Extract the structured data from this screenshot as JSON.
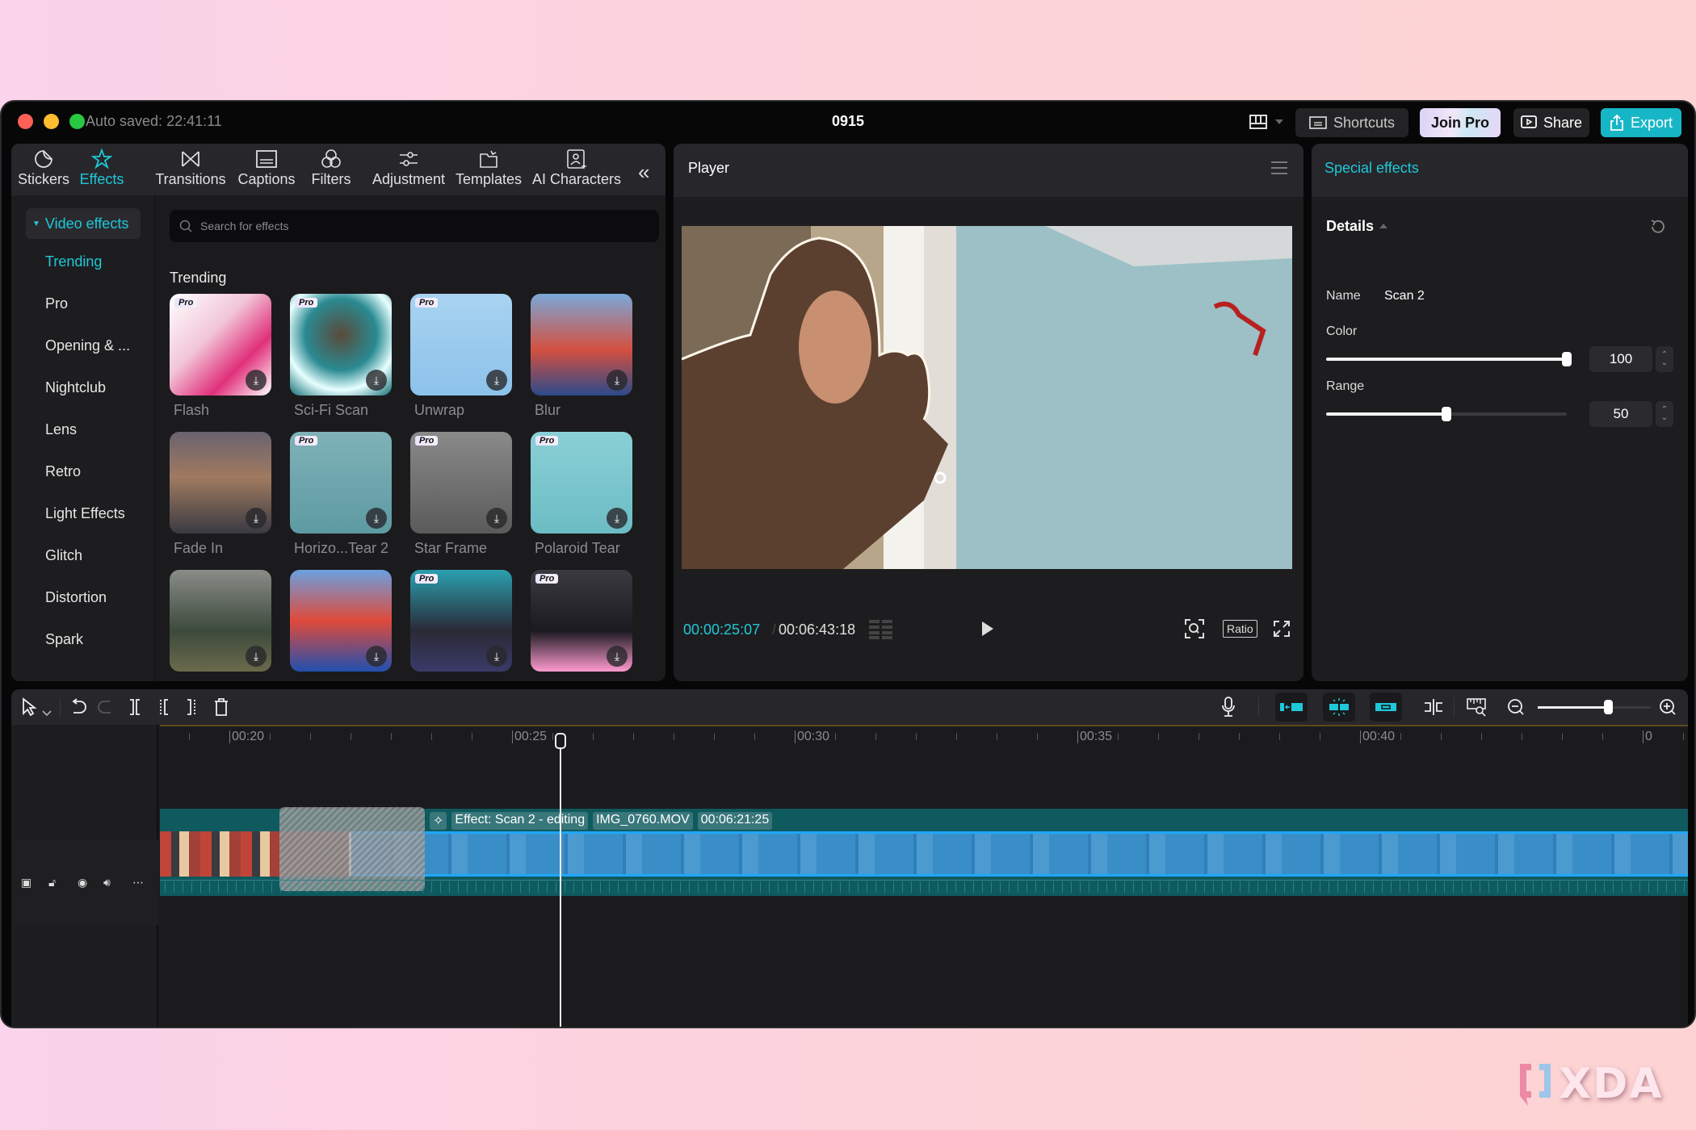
{
  "window": {
    "autosave": "Auto saved: 22:41:11",
    "title": "0915",
    "buttons": {
      "shortcuts": "Shortcuts",
      "join_pro": "Join Pro",
      "share": "Share",
      "export": "Export"
    },
    "accent_color": "#1fc8d8"
  },
  "left_panel": {
    "tabs": [
      {
        "label": "Stickers",
        "icon": "sticker-icon"
      },
      {
        "label": "Effects",
        "icon": "sparkle-star-icon",
        "active": true
      },
      {
        "label": "Transitions",
        "icon": "bowtie-icon"
      },
      {
        "label": "Captions",
        "icon": "captions-icon"
      },
      {
        "label": "Filters",
        "icon": "filters-circles-icon"
      },
      {
        "label": "Adjustment",
        "icon": "sliders-icon"
      },
      {
        "label": "Templates",
        "icon": "templates-icon"
      },
      {
        "label": "AI Characters",
        "icon": "ai-character-icon"
      }
    ],
    "category_header": "Video effects",
    "categories": [
      "Trending",
      "Pro",
      "Opening & ...",
      "Nightclub",
      "Lens",
      "Retro",
      "Light Effects",
      "Glitch",
      "Distortion",
      "Spark"
    ],
    "active_category": "Trending",
    "search_placeholder": "Search for effects",
    "section_title": "Trending",
    "pro_badge": "Pro",
    "effects": [
      {
        "label": "Flash",
        "pro": true
      },
      {
        "label": "Sci-Fi Scan",
        "pro": true
      },
      {
        "label": "Unwrap",
        "pro": true
      },
      {
        "label": "Blur",
        "pro": false
      },
      {
        "label": "Fade In",
        "pro": false
      },
      {
        "label": "Horizo...Tear 2",
        "pro": true
      },
      {
        "label": "Star Frame",
        "pro": true
      },
      {
        "label": "Polaroid Tear",
        "pro": true
      },
      {
        "label": "",
        "pro": false
      },
      {
        "label": "",
        "pro": false
      },
      {
        "label": "",
        "pro": true
      },
      {
        "label": "",
        "pro": true
      }
    ]
  },
  "player": {
    "title": "Player",
    "current_time": "00:00:25:07",
    "separator": "/",
    "total_time": "00:06:43:18",
    "ratio_label": "Ratio"
  },
  "right_panel": {
    "title": "Special effects",
    "details_label": "Details",
    "name_label": "Name",
    "name_value": "Scan 2",
    "color_label": "Color",
    "color_value": "100",
    "color_fraction": 1.0,
    "range_label": "Range",
    "range_value": "50",
    "range_fraction": 0.5
  },
  "timeline": {
    "ruler_labels": [
      "00:20",
      "00:25",
      "00:30",
      "00:35",
      "00:40",
      "0"
    ],
    "clip": {
      "effect_label": "Effect: Scan 2 - editing",
      "file_name": "IMG_0760.MOV",
      "duration": "00:06:21:25"
    },
    "zoom_level_fraction": 0.62
  },
  "watermark": "XDA"
}
